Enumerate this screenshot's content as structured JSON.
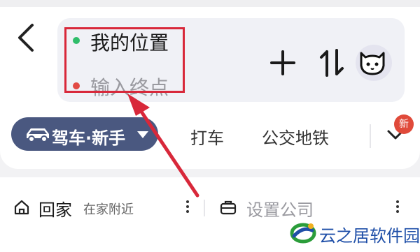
{
  "route": {
    "origin": "我的位置",
    "destination_placeholder": "输入终点"
  },
  "modes": {
    "active_label": "驾车·新手",
    "taxi_label": "打车",
    "transit_label": "公交地铁",
    "new_badge": "新"
  },
  "shortcuts": {
    "home_label": "回家",
    "home_hint": "在家附近",
    "work_label": "设置公司"
  },
  "watermark": {
    "text": "云之居软件园"
  },
  "colors": {
    "origin_dot": "#2fbd6a",
    "destination_dot": "#e24a44",
    "active_mode_bg": "#4a5880",
    "annotation_red": "#d8283a",
    "badge": "#e04a3a"
  },
  "icons": {
    "back": "back-arrow-icon",
    "add": "plus-icon",
    "swap": "swap-icon",
    "avatar": "cat-avatar-icon",
    "car": "car-icon",
    "home": "home-icon",
    "work": "briefcase-icon",
    "more": "chevron-down-icon",
    "menu": "more-vertical-icon"
  }
}
